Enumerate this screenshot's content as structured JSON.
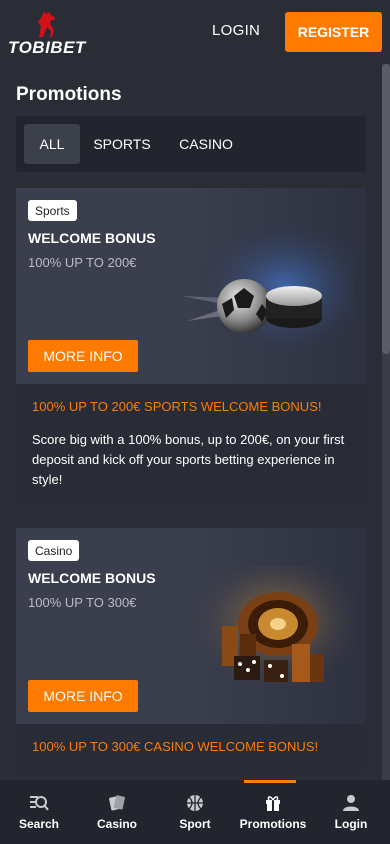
{
  "header": {
    "brand": "TOBIBET",
    "login_label": "LOGIN",
    "register_label": "REGISTER",
    "accent_color": "#ff7a00"
  },
  "page": {
    "title": "Promotions"
  },
  "filters": [
    {
      "label": "ALL",
      "active": true
    },
    {
      "label": "SPORTS",
      "active": false
    },
    {
      "label": "CASINO",
      "active": false
    }
  ],
  "promos": [
    {
      "badge": "Sports",
      "title": "WELCOME BONUS",
      "subtitle": "100% UP TO 200€",
      "button_label": "MORE INFO",
      "headline": "100% UP TO 200€ SPORTS WELCOME BONUS!",
      "description": "Score big with a 100% bonus, up to 200€, on your first deposit and kick off your sports betting experience in style!",
      "image_icon": "soccer-ball-and-puck-image"
    },
    {
      "badge": "Casino",
      "title": "WELCOME BONUS",
      "subtitle": "100% UP TO 300€",
      "button_label": "MORE INFO",
      "headline": "100% UP TO 300€ CASINO WELCOME BONUS!",
      "image_icon": "roulette-and-chips-image"
    }
  ],
  "bottom_nav": [
    {
      "label": "Search",
      "icon": "search-icon"
    },
    {
      "label": "Casino",
      "icon": "cards-icon"
    },
    {
      "label": "Sport",
      "icon": "basketball-icon"
    },
    {
      "label": "Promotions",
      "icon": "gift-icon",
      "active": true
    },
    {
      "label": "Login",
      "icon": "user-icon"
    }
  ]
}
